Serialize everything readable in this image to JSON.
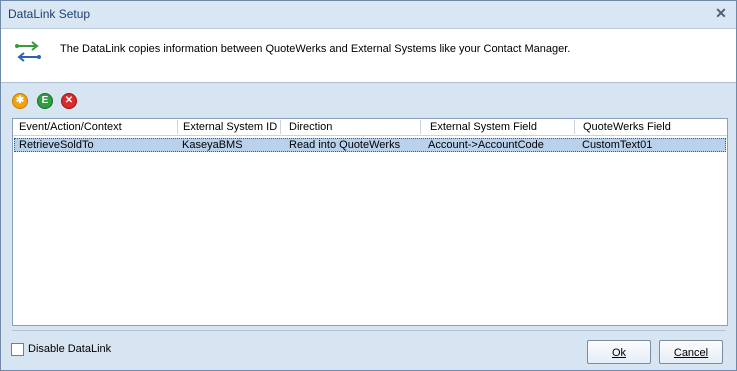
{
  "window": {
    "title": "DataLink Setup",
    "close_glyph": "✕"
  },
  "banner": {
    "icon": "datalink-arrows-icon",
    "text": "The DataLink copies information between QuoteWerks and External Systems like your Contact Manager."
  },
  "toolbar": {
    "add_icon": "add-icon",
    "edit_icon": "edit-icon",
    "delete_icon": "delete-icon",
    "add_glyph": "✱",
    "edit_glyph": "E",
    "delete_glyph": "✕"
  },
  "grid": {
    "columns": [
      "Event/Action/Context",
      "External System ID",
      "Direction",
      "External System Field",
      "QuoteWerks Field"
    ],
    "rows": [
      {
        "event": "RetrieveSoldTo",
        "system_id": "KaseyaBMS",
        "direction": "Read into QuoteWerks",
        "system_field": "Account->AccountCode",
        "qw_field": "CustomText01",
        "selected": true
      }
    ]
  },
  "footer": {
    "disable_label": "Disable DataLink",
    "disable_checked": false,
    "ok_label": "Ok",
    "cancel_label": "Cancel"
  },
  "colors": {
    "accent": "#1d3f6e",
    "selection": "#b9d1ea",
    "background": "#d7e4f2"
  }
}
